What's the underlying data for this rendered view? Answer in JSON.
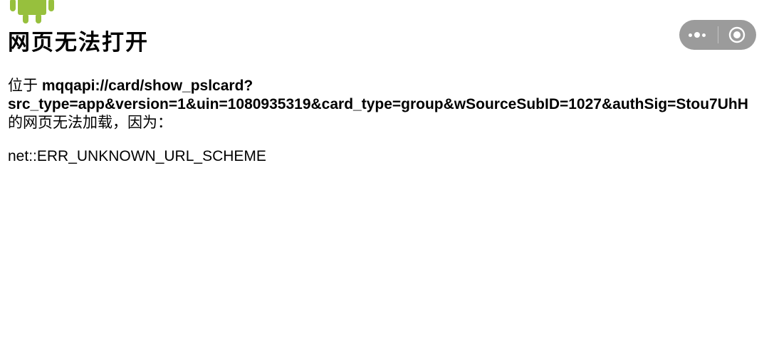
{
  "page": {
    "title": "网页无法打开",
    "prefix": "位于 ",
    "url_line1": "mqqapi://card/show_pslcard?",
    "url_line2": "src_type=app&version=1&uin=1080935319&card_type=group&wSourceSubID=1027&authSig=Stou7UhH",
    "suffix": "的网页无法加载，因为：",
    "error_code": "net::ERR_UNKNOWN_URL_SCHEME"
  },
  "capsule": {
    "more_icon": "more-dots-icon",
    "close_icon": "target-circle-icon",
    "background": "#9b9b9b"
  },
  "icons": {
    "logo": "android-robot-icon",
    "logo_color": "#97c03d"
  }
}
